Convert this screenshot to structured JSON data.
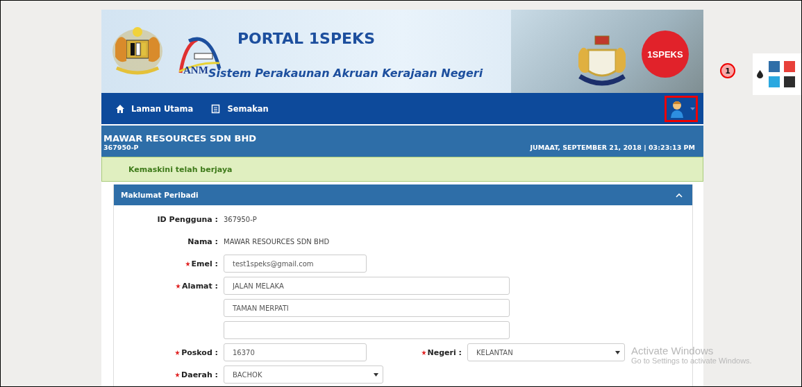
{
  "banner": {
    "title": "PORTAL 1SPEKS",
    "agency": "ANM",
    "subtitle": "Sistem Perakaunan Akruan Kerajaan Negeri",
    "badge": "1SPEKS"
  },
  "nav": {
    "items": [
      {
        "label": "Laman Utama"
      },
      {
        "label": "Semakan"
      }
    ]
  },
  "company": {
    "name": "MAWAR RESOURCES SDN BHD",
    "id": "367950-P",
    "datetime": "JUMAAT, SEPTEMBER 21, 2018 | 03:23:13 PM"
  },
  "alert": {
    "text": "Kemaskini telah berjaya"
  },
  "panel": {
    "title": "Maklumat Peribadi",
    "expanded": true,
    "rows": [
      {
        "fields": [
          {
            "kind": "text",
            "label": "ID Pengguna :",
            "required": false,
            "value": "367950-P"
          }
        ]
      },
      {
        "fields": [
          {
            "kind": "text",
            "label": "Nama :",
            "required": false,
            "value": "MAWAR RESOURCES SDN BHD"
          }
        ]
      },
      {
        "fields": [
          {
            "kind": "short_input",
            "label": "Emel :",
            "required": true,
            "value": "test1speks@gmail.com"
          }
        ]
      },
      {
        "fields": [
          {
            "kind": "long_input",
            "label": "Alamat :",
            "required": true,
            "value": "JALAN MELAKA"
          }
        ]
      },
      {
        "fields": [
          {
            "kind": "long_input",
            "value": "TAMAN MERPATI"
          }
        ]
      },
      {
        "fields": [
          {
            "kind": "long_input"
          }
        ]
      },
      {
        "fields": [
          {
            "kind": "short_input",
            "label": "Poskod :",
            "required": true,
            "value": "16370"
          },
          {
            "kind": "select",
            "label": "Negeri :",
            "required": true,
            "value": "KELANTAN"
          }
        ]
      },
      {
        "fields": [
          {
            "kind": "select",
            "label": "Daerah :",
            "required": true,
            "value": "BACHOK"
          }
        ]
      }
    ]
  },
  "callout": {
    "number": "1"
  },
  "theme_swatches": [
    {
      "color": "#2f6ea8"
    },
    {
      "color": "#e8403a"
    },
    {
      "color": "#2aa8e0"
    },
    {
      "color": "#2e2e2e"
    }
  ],
  "os_notice": {
    "title": "Activate Windows",
    "text": "Go to Settings to activate Windows."
  }
}
